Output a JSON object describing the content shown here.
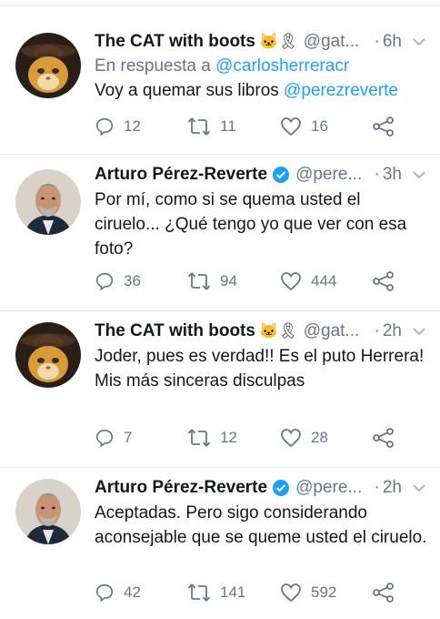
{
  "tweets": [
    {
      "name": "The CAT with boots",
      "emoji": "🐱🎗",
      "handle": "@gat...",
      "time": "6h",
      "verified": false,
      "reply_prefix": "En respuesta a",
      "reply_mention": "@carlosherreracr",
      "text": "Voy a quemar sus libros",
      "text_mention": "@perezreverte",
      "replies": "12",
      "retweets": "11",
      "likes": "16"
    },
    {
      "name": "Arturo Pérez-Reverte",
      "handle": "@pere...",
      "time": "3h",
      "verified": true,
      "text": "Por mí, como si se quema usted el ciruelo... ¿Qué tengo yo que ver con esa foto?",
      "replies": "36",
      "retweets": "94",
      "likes": "444"
    },
    {
      "name": "The CAT with boots",
      "emoji": "🐱🎗",
      "handle": "@gat...",
      "time": "2h",
      "verified": false,
      "text_line1": "Joder, pues es verdad!! Es el puto Herrera!",
      "text_line2": "Mis más sinceras disculpas",
      "replies": "7",
      "retweets": "12",
      "likes": "28"
    },
    {
      "name": "Arturo Pérez-Reverte",
      "handle": "@pere...",
      "time": "2h",
      "verified": true,
      "text": "Aceptadas. Pero sigo considerando aconsejable que se queme usted el ciruelo.",
      "replies": "42",
      "retweets": "141",
      "likes": "592"
    }
  ],
  "colors": {
    "accent": "#1da1f2",
    "muted": "#657786",
    "text": "#14171a"
  },
  "icons": {
    "reply": "reply-icon",
    "retweet": "retweet-icon",
    "like": "heart-icon",
    "share": "share-icon",
    "more": "chevron-down-icon",
    "verified": "verified-badge-icon"
  }
}
